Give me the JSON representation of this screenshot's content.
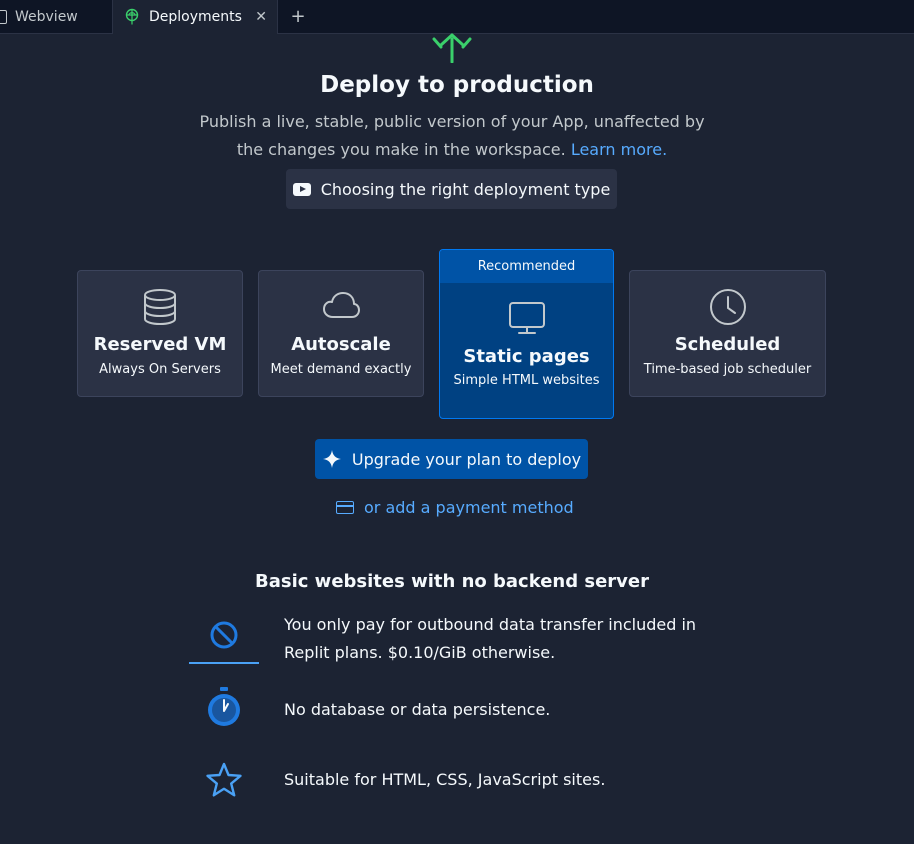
{
  "tabs": [
    {
      "label": "Webview"
    },
    {
      "label": "Deployments"
    }
  ],
  "hero": {
    "title": "Deploy to production",
    "subtitle_1": "Publish a live, stable, public version of your App, unaffected by",
    "subtitle_2": "the changes you make in the workspace.",
    "learn_more": "Learn more.",
    "video_label": "Choosing the right deployment type"
  },
  "deploy_types": [
    {
      "title": "Reserved VM",
      "subtitle": "Always On Servers",
      "icon": "database-icon"
    },
    {
      "title": "Autoscale",
      "subtitle": "Meet demand exactly",
      "icon": "cloud-icon"
    },
    {
      "title": "Static pages",
      "subtitle": "Simple HTML websites",
      "icon": "monitor-icon",
      "badge": "Recommended",
      "selected": true
    },
    {
      "title": "Scheduled",
      "subtitle": "Time-based job scheduler",
      "icon": "clock-icon"
    }
  ],
  "upgrade_label": "Upgrade your plan to deploy",
  "payment_label": "or add a payment method",
  "features": {
    "title": "Basic websites with no backend server",
    "items": [
      {
        "line1": "You only pay for outbound data transfer included in",
        "line2": "Replit plans. $0.10/GiB otherwise.",
        "icon": "no-icon"
      },
      {
        "line1": "No database or data persistence.",
        "icon": "stopwatch-icon"
      },
      {
        "line1": "Suitable for HTML, CSS, JavaScript sites.",
        "icon": "star-icon"
      }
    ]
  },
  "colors": {
    "background": "#1c2333",
    "card": "#2b3245",
    "selected_card": "#004182",
    "accent_blue": "#0053a6",
    "link": "#57abff",
    "hero_green": "#3ad06b"
  }
}
